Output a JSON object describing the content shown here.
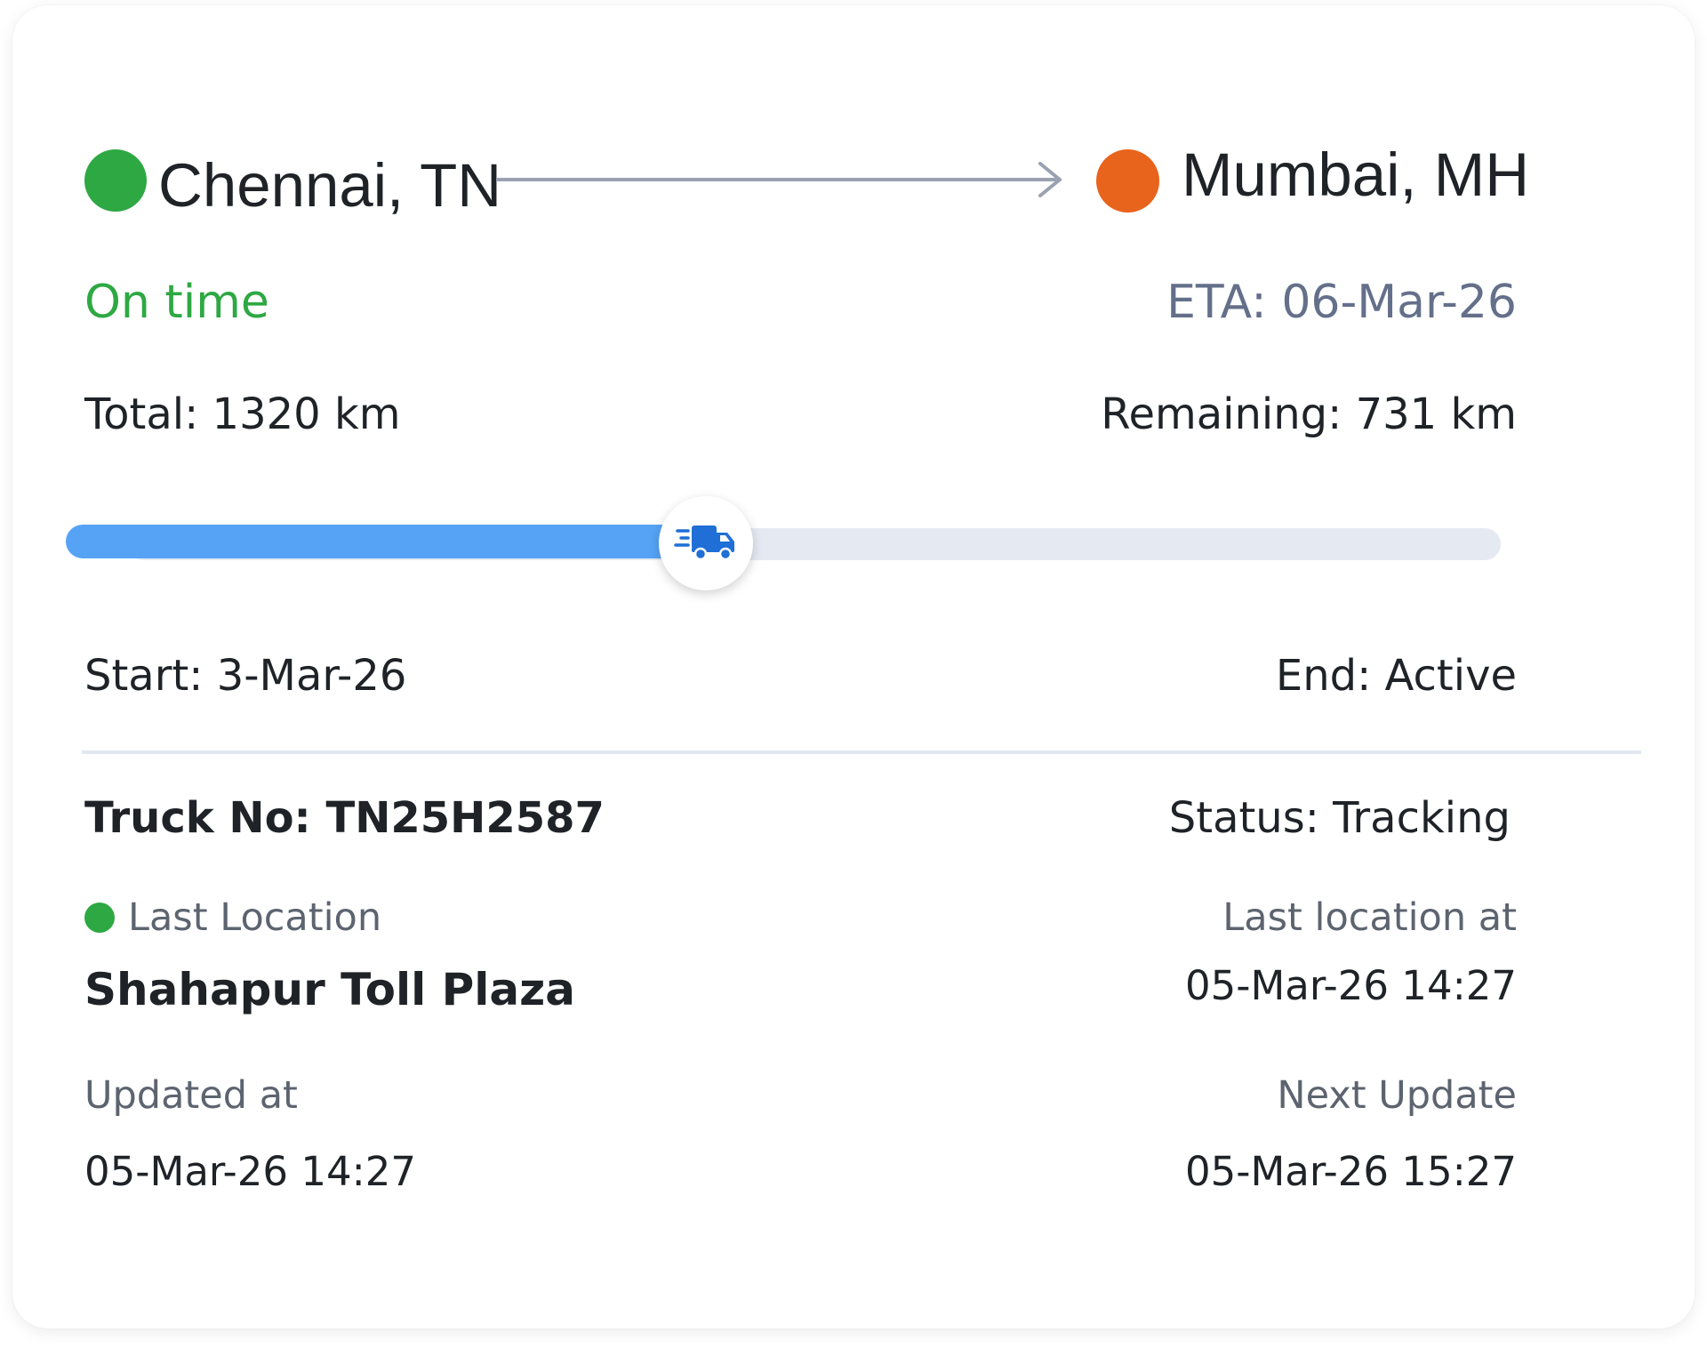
{
  "route": {
    "origin": "Chennai, TN",
    "destination": "Mumbai, MH",
    "origin_color": "#2ea843",
    "destination_color": "#e8631c",
    "arrow_icon": "right-arrow-icon"
  },
  "schedule": {
    "status": "On time",
    "status_color": "#2ea843",
    "eta": "ETA: 06-Mar-26"
  },
  "distance": {
    "total": "Total: 1320 km",
    "remaining": "Remaining: 731 km",
    "progress_fraction": 0.446
  },
  "progress": {
    "fill_color": "#56a3f5",
    "track_color": "#e5e9f2",
    "knob_icon": "fast-delivery-truck-icon"
  },
  "trip": {
    "start": "Start: 3-Mar-26",
    "end": "End: Active"
  },
  "truck": {
    "number": "Truck No: TN25H2587",
    "status": "Status: Tracking"
  },
  "location": {
    "label": "Last Location",
    "value": "Shahapur Toll Plaza",
    "at_label": "Last location at",
    "at_value": "05-Mar-26 14:27"
  },
  "updates": {
    "updated_label": "Updated at",
    "updated_value": "05-Mar-26 14:27",
    "next_label": "Next Update",
    "next_value": "05-Mar-26 15:27"
  }
}
